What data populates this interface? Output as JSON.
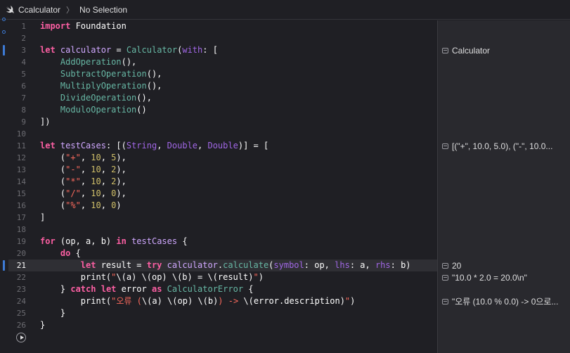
{
  "jumpbar": {
    "file_name": "Ccalculator",
    "separator": "〉",
    "selection": "No Selection",
    "file_icon": "swift-icon"
  },
  "colors": {
    "keyword": "#fc5fa3",
    "type": "#d0a8ff",
    "function": "#67b7a4",
    "property": "#a167e6",
    "string": "#fc6a5d",
    "number": "#d0bf69",
    "plain": "#ffffff",
    "gutter_accent": "#3d7bd6"
  },
  "current_line": 21,
  "lines": [
    {
      "n": "1",
      "tokens": [
        {
          "t": "import",
          "c": "kw"
        },
        {
          "t": " Foundation",
          "c": "pl"
        }
      ]
    },
    {
      "n": "2",
      "tokens": []
    },
    {
      "n": "3",
      "tokens": [
        {
          "t": "let",
          "c": "kw"
        },
        {
          "t": " ",
          "c": "pl"
        },
        {
          "t": "calculator",
          "c": "ty"
        },
        {
          "t": " = ",
          "c": "pl"
        },
        {
          "t": "Calculator",
          "c": "fn"
        },
        {
          "t": "(",
          "c": "pl"
        },
        {
          "t": "with",
          "c": "pr"
        },
        {
          "t": ": [",
          "c": "pl"
        }
      ]
    },
    {
      "n": "4",
      "tokens": [
        {
          "t": "    ",
          "c": "pl"
        },
        {
          "t": "AddOperation",
          "c": "fn"
        },
        {
          "t": "(),",
          "c": "pl"
        }
      ]
    },
    {
      "n": "5",
      "tokens": [
        {
          "t": "    ",
          "c": "pl"
        },
        {
          "t": "SubtractOperation",
          "c": "fn"
        },
        {
          "t": "(),",
          "c": "pl"
        }
      ]
    },
    {
      "n": "6",
      "tokens": [
        {
          "t": "    ",
          "c": "pl"
        },
        {
          "t": "MultiplyOperation",
          "c": "fn"
        },
        {
          "t": "(),",
          "c": "pl"
        }
      ]
    },
    {
      "n": "7",
      "tokens": [
        {
          "t": "    ",
          "c": "pl"
        },
        {
          "t": "DivideOperation",
          "c": "fn"
        },
        {
          "t": "(),",
          "c": "pl"
        }
      ]
    },
    {
      "n": "8",
      "tokens": [
        {
          "t": "    ",
          "c": "pl"
        },
        {
          "t": "ModuloOperation",
          "c": "fn"
        },
        {
          "t": "()",
          "c": "pl"
        }
      ]
    },
    {
      "n": "9",
      "tokens": [
        {
          "t": "])",
          "c": "pl"
        }
      ]
    },
    {
      "n": "10",
      "tokens": []
    },
    {
      "n": "11",
      "tokens": [
        {
          "t": "let",
          "c": "kw"
        },
        {
          "t": " ",
          "c": "pl"
        },
        {
          "t": "testCases",
          "c": "ty"
        },
        {
          "t": ": [(",
          "c": "pl"
        },
        {
          "t": "String",
          "c": "pr"
        },
        {
          "t": ", ",
          "c": "pl"
        },
        {
          "t": "Double",
          "c": "pr"
        },
        {
          "t": ", ",
          "c": "pl"
        },
        {
          "t": "Double",
          "c": "pr"
        },
        {
          "t": ")] = [",
          "c": "pl"
        }
      ]
    },
    {
      "n": "12",
      "tokens": [
        {
          "t": "    (",
          "c": "pl"
        },
        {
          "t": "\"+\"",
          "c": "st"
        },
        {
          "t": ", ",
          "c": "pl"
        },
        {
          "t": "10",
          "c": "nu"
        },
        {
          "t": ", ",
          "c": "pl"
        },
        {
          "t": "5",
          "c": "nu"
        },
        {
          "t": "),",
          "c": "pl"
        }
      ]
    },
    {
      "n": "13",
      "tokens": [
        {
          "t": "    (",
          "c": "pl"
        },
        {
          "t": "\"-\"",
          "c": "st"
        },
        {
          "t": ", ",
          "c": "pl"
        },
        {
          "t": "10",
          "c": "nu"
        },
        {
          "t": ", ",
          "c": "pl"
        },
        {
          "t": "2",
          "c": "nu"
        },
        {
          "t": "),",
          "c": "pl"
        }
      ]
    },
    {
      "n": "14",
      "tokens": [
        {
          "t": "    (",
          "c": "pl"
        },
        {
          "t": "\"*\"",
          "c": "st"
        },
        {
          "t": ", ",
          "c": "pl"
        },
        {
          "t": "10",
          "c": "nu"
        },
        {
          "t": ", ",
          "c": "pl"
        },
        {
          "t": "2",
          "c": "nu"
        },
        {
          "t": "),",
          "c": "pl"
        }
      ]
    },
    {
      "n": "15",
      "tokens": [
        {
          "t": "    (",
          "c": "pl"
        },
        {
          "t": "\"/\"",
          "c": "st"
        },
        {
          "t": ", ",
          "c": "pl"
        },
        {
          "t": "10",
          "c": "nu"
        },
        {
          "t": ", ",
          "c": "pl"
        },
        {
          "t": "0",
          "c": "nu"
        },
        {
          "t": "),",
          "c": "pl"
        }
      ]
    },
    {
      "n": "16",
      "tokens": [
        {
          "t": "    (",
          "c": "pl"
        },
        {
          "t": "\"%\"",
          "c": "st"
        },
        {
          "t": ", ",
          "c": "pl"
        },
        {
          "t": "10",
          "c": "nu"
        },
        {
          "t": ", ",
          "c": "pl"
        },
        {
          "t": "0",
          "c": "nu"
        },
        {
          "t": ")",
          "c": "pl"
        }
      ]
    },
    {
      "n": "17",
      "tokens": [
        {
          "t": "]",
          "c": "pl"
        }
      ]
    },
    {
      "n": "18",
      "tokens": []
    },
    {
      "n": "19",
      "tokens": [
        {
          "t": "for",
          "c": "kw"
        },
        {
          "t": " (op, a, b) ",
          "c": "pl"
        },
        {
          "t": "in",
          "c": "kw"
        },
        {
          "t": " ",
          "c": "pl"
        },
        {
          "t": "testCases",
          "c": "ty"
        },
        {
          "t": " {",
          "c": "pl"
        }
      ]
    },
    {
      "n": "20",
      "tokens": [
        {
          "t": "    ",
          "c": "pl"
        },
        {
          "t": "do",
          "c": "kw"
        },
        {
          "t": " {",
          "c": "pl"
        }
      ]
    },
    {
      "n": "21",
      "tokens": [
        {
          "t": "        ",
          "c": "pl"
        },
        {
          "t": "let",
          "c": "kw"
        },
        {
          "t": " result = ",
          "c": "pl"
        },
        {
          "t": "try",
          "c": "kw"
        },
        {
          "t": " ",
          "c": "pl"
        },
        {
          "t": "calculator",
          "c": "ty"
        },
        {
          "t": ".",
          "c": "pl"
        },
        {
          "t": "calculate",
          "c": "fn"
        },
        {
          "t": "(",
          "c": "pl"
        },
        {
          "t": "symbol",
          "c": "pr"
        },
        {
          "t": ": op, ",
          "c": "pl"
        },
        {
          "t": "lhs",
          "c": "pr"
        },
        {
          "t": ": a, ",
          "c": "pl"
        },
        {
          "t": "rhs",
          "c": "pr"
        },
        {
          "t": ": b)",
          "c": "pl"
        }
      ]
    },
    {
      "n": "22",
      "tokens": [
        {
          "t": "        ",
          "c": "pl"
        },
        {
          "t": "print",
          "c": "pl"
        },
        {
          "t": "(",
          "c": "pl"
        },
        {
          "t": "\"",
          "c": "st"
        },
        {
          "t": "\\(a) \\(op) \\(b) = \\(result)",
          "c": "pl"
        },
        {
          "t": "\"",
          "c": "st"
        },
        {
          "t": ")",
          "c": "pl"
        }
      ]
    },
    {
      "n": "23",
      "tokens": [
        {
          "t": "    } ",
          "c": "pl"
        },
        {
          "t": "catch",
          "c": "kw"
        },
        {
          "t": " ",
          "c": "pl"
        },
        {
          "t": "let",
          "c": "kw"
        },
        {
          "t": " error ",
          "c": "pl"
        },
        {
          "t": "as",
          "c": "kw"
        },
        {
          "t": " ",
          "c": "pl"
        },
        {
          "t": "CalculatorError",
          "c": "fn"
        },
        {
          "t": " {",
          "c": "pl"
        }
      ]
    },
    {
      "n": "24",
      "tokens": [
        {
          "t": "        ",
          "c": "pl"
        },
        {
          "t": "print",
          "c": "pl"
        },
        {
          "t": "(",
          "c": "pl"
        },
        {
          "t": "\"오류 (",
          "c": "st"
        },
        {
          "t": "\\(a) \\(op) \\(b)",
          "c": "pl"
        },
        {
          "t": ") -> ",
          "c": "st"
        },
        {
          "t": "\\(error.description)",
          "c": "pl"
        },
        {
          "t": "\"",
          "c": "st"
        },
        {
          "t": ")",
          "c": "pl"
        }
      ]
    },
    {
      "n": "25",
      "tokens": [
        {
          "t": "    }",
          "c": "pl"
        }
      ]
    },
    {
      "n": "26",
      "tokens": [
        {
          "t": "}",
          "c": "pl"
        }
      ]
    }
  ],
  "results": [
    {
      "line": 3,
      "text": "Calculator"
    },
    {
      "line": 11,
      "text": "[(\"+\", 10.0, 5.0), (\"-\", 10.0..."
    },
    {
      "line": 21,
      "text": "20"
    },
    {
      "line": 22,
      "text": "\"10.0 * 2.0 = 20.0\\n\""
    },
    {
      "line": 24,
      "text": "\"오류 (10.0 % 0.0) -> 0으로..."
    }
  ],
  "run_button_icon": "play-icon"
}
